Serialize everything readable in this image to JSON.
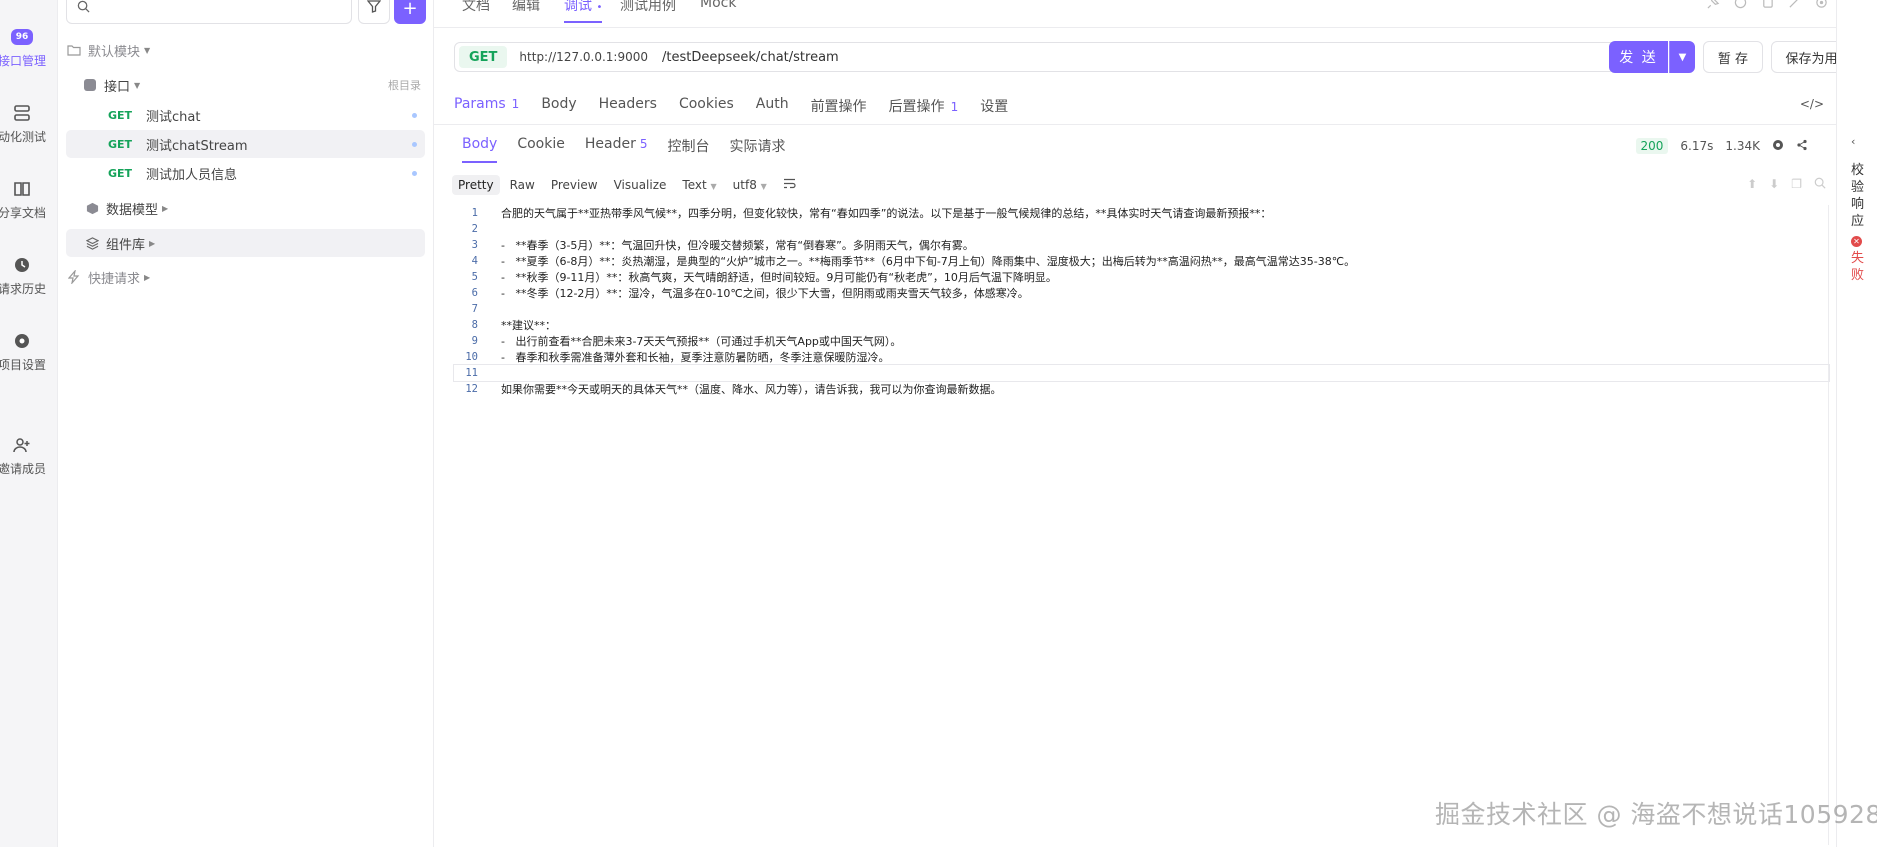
{
  "rail": {
    "items": [
      {
        "label": "接口管理",
        "icon": "api-badge-icon",
        "badge": "96"
      },
      {
        "label": "动化测试",
        "icon": "automation-icon"
      },
      {
        "label": "分享文档",
        "icon": "book-icon"
      },
      {
        "label": "请求历史",
        "icon": "clock-icon"
      },
      {
        "label": "项目设置",
        "icon": "gear-icon"
      },
      {
        "label": "邀请成员",
        "icon": "add-user-icon"
      }
    ]
  },
  "tree": {
    "default_module": "默认模块",
    "api_folder": "接口",
    "root_dir_hint": "根目录",
    "endpoints": [
      {
        "method": "GET",
        "name": "测试chat"
      },
      {
        "method": "GET",
        "name": "测试chatStream"
      },
      {
        "method": "GET",
        "name": "测试加人员信息"
      }
    ],
    "data_model": "数据模型",
    "component_lib": "组件库",
    "quick_request": "快捷请求"
  },
  "top_tabs": [
    "文档",
    "编辑",
    "调试",
    "测试用例",
    "Mock"
  ],
  "top_tab_active_suffix": "•",
  "request": {
    "method": "GET",
    "base_url": "http://127.0.0.1:9000",
    "path": "/testDeepseek/chat/stream",
    "send_label": "发 送",
    "save_draft_label": "暂 存",
    "save_case_label": "保存为用例"
  },
  "request_tabs": [
    {
      "label": "Params",
      "count": "1"
    },
    {
      "label": "Body",
      "count": ""
    },
    {
      "label": "Headers",
      "count": ""
    },
    {
      "label": "Cookies",
      "count": ""
    },
    {
      "label": "Auth",
      "count": ""
    },
    {
      "label": "前置操作",
      "count": ""
    },
    {
      "label": "后置操作",
      "count": "1"
    },
    {
      "label": "设置",
      "count": ""
    }
  ],
  "response_tabs": [
    {
      "label": "Body",
      "count": ""
    },
    {
      "label": "Cookie",
      "count": ""
    },
    {
      "label": "Header",
      "count": "5"
    },
    {
      "label": "控制台",
      "count": ""
    },
    {
      "label": "实际请求",
      "count": ""
    }
  ],
  "response_meta": {
    "status": "200",
    "time": "6.17s",
    "size": "1.34K"
  },
  "view_modes": [
    "Pretty",
    "Raw",
    "Preview",
    "Visualize"
  ],
  "format_select": "Text",
  "encoding_select": "utf8",
  "body_lines": [
    "合肥的天气属于**亚热带季风气候**，四季分明，但变化较快，常有“春如四季”的说法。以下是基于一般气候规律的总结，**具体实时天气请查询最新预报**：",
    "",
    "-   **春季（3-5月）**：气温回升快，但冷暖交替频繁，常有“倒春寒”。多阴雨天气，偶尔有雾。",
    "-   **夏季（6-8月）**：炎热潮湿，是典型的“火炉”城市之一。**梅雨季节**（6月中下旬-7月上旬）降雨集中、湿度极大；出梅后转为**高温闷热**，最高气温常达35-38℃。",
    "-   **秋季（9-11月）**：秋高气爽，天气晴朗舒适，但时间较短。9月可能仍有“秋老虎”，10月后气温下降明显。",
    "-   **冬季（12-2月）**：湿冷，气温多在0-10℃之间，很少下大雪，但阴雨或雨夹雪天气较多，体感寒冷。",
    "",
    "**建议**：",
    "-   出行前查看**合肥未来3-7天天气预报**（可通过手机天气App或中国天气网）。",
    "-   春季和秋季需准备薄外套和长袖，夏季注意防暑防晒，冬季注意保暖防湿冷。",
    "",
    "如果你需要**今天或明天的具体天气**（温度、降水、风力等），请告诉我，我可以为你查询最新数据。"
  ],
  "validation_rail": {
    "label": "校验响应",
    "fail": "失败"
  },
  "watermark": "掘金技术社区 @ 海盗不想说话105928",
  "colors": {
    "accent": "#7b61ff",
    "get": "#15a35a",
    "fail": "#e24b4b"
  }
}
